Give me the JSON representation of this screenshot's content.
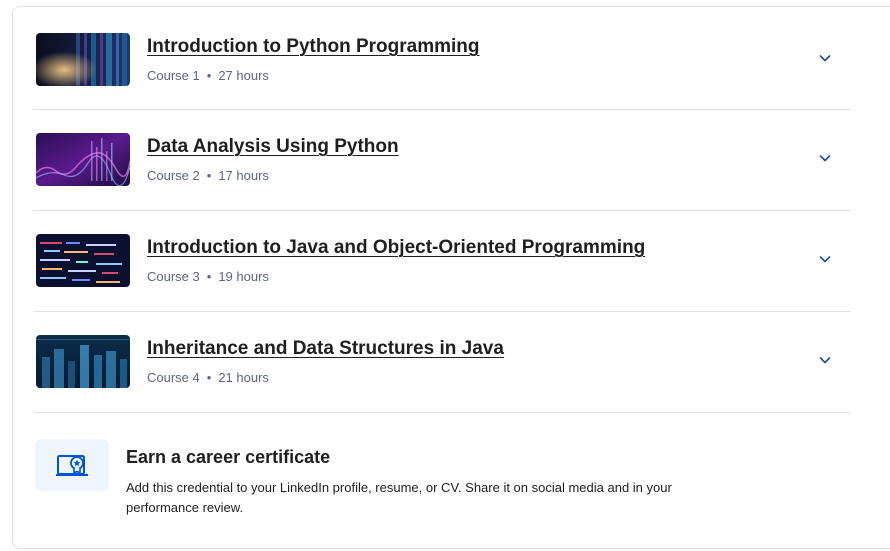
{
  "courses": [
    {
      "title": "Introduction to Python Programming",
      "course_label": "Course 1",
      "duration": "27 hours",
      "thumbnail": "server-lights-image"
    },
    {
      "title": "Data Analysis Using Python",
      "course_label": "Course 2",
      "duration": "17 hours",
      "thumbnail": "data-wave-image"
    },
    {
      "title": "Introduction to Java and Object-Oriented Programming",
      "course_label": "Course 3",
      "duration": "19 hours",
      "thumbnail": "code-screen-image"
    },
    {
      "title": "Inheritance and Data Structures in Java",
      "course_label": "Course 4",
      "duration": "21 hours",
      "thumbnail": "data-city-image"
    }
  ],
  "separator": "•",
  "certificate": {
    "title": "Earn a career certificate",
    "description": "Add this credential to your LinkedIn profile, resume, or CV. Share it on social media and in your performance review.",
    "icon": "certificate-icon"
  },
  "colors": {
    "accent": "#0056d2",
    "text": "#1f1f1f",
    "muted": "#5b6780",
    "divider": "#dfe3e7",
    "icon_bg": "#f0f6ff"
  }
}
